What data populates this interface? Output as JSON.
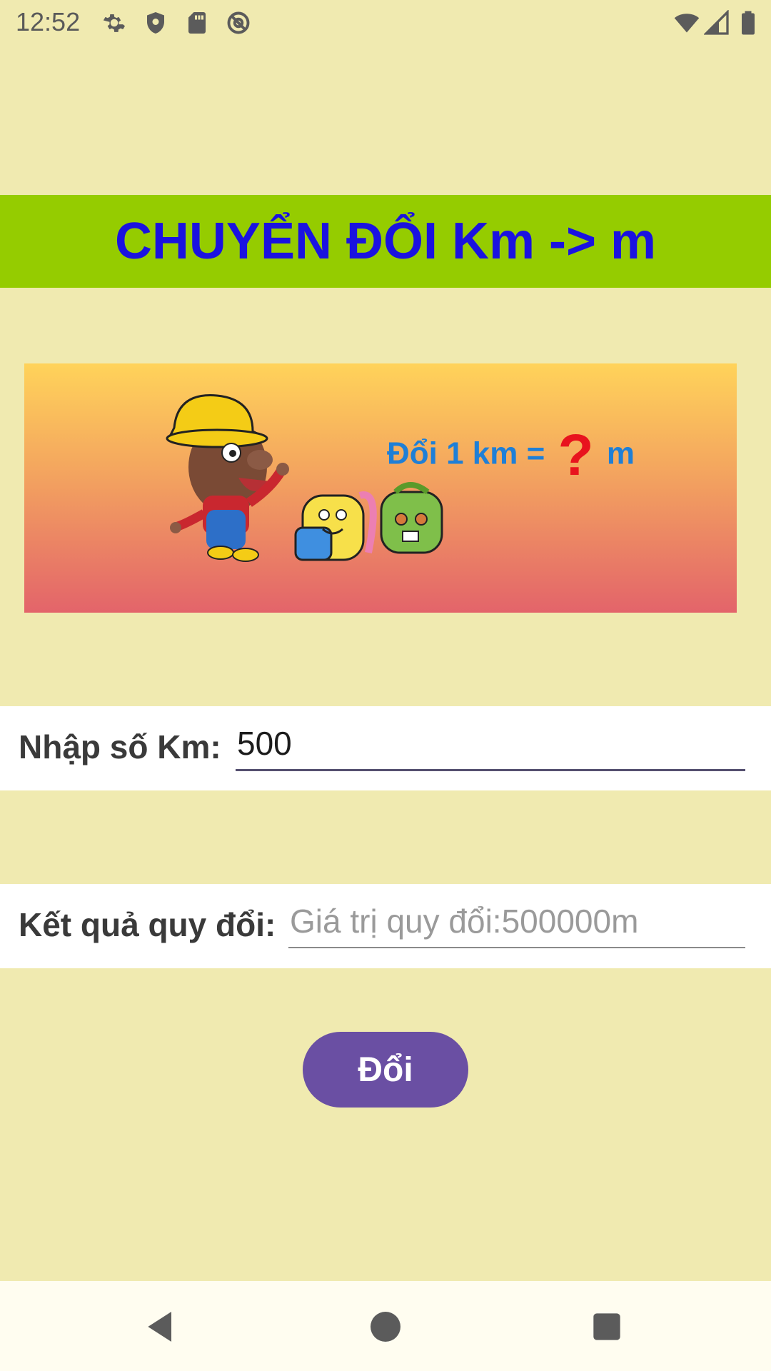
{
  "status_bar": {
    "time": "12:52",
    "left_icons": [
      "gear-icon",
      "shield-icon",
      "sd-card-icon",
      "at-sign-icon"
    ],
    "right_icons": [
      "wifi-icon",
      "cell-signal-icon",
      "battery-icon"
    ]
  },
  "header": {
    "title": "CHUYỂN ĐỔI Km -> m",
    "title_color": "#1a12e0",
    "bar_color": "#95cc00"
  },
  "banner": {
    "text_prefix": "Đổi 1 km = ",
    "question_mark": "?",
    "text_suffix": " m"
  },
  "form": {
    "km_label": "Nhập số Km:",
    "km_value": "500",
    "result_label": "Kết quả quy đổi:",
    "result_placeholder": "Giá trị quy đổi:500000m"
  },
  "actions": {
    "convert_label": "Đổi",
    "convert_color": "#6a4fa3"
  },
  "nav_bar": {
    "buttons": [
      "back-icon",
      "home-icon",
      "recents-icon"
    ]
  }
}
